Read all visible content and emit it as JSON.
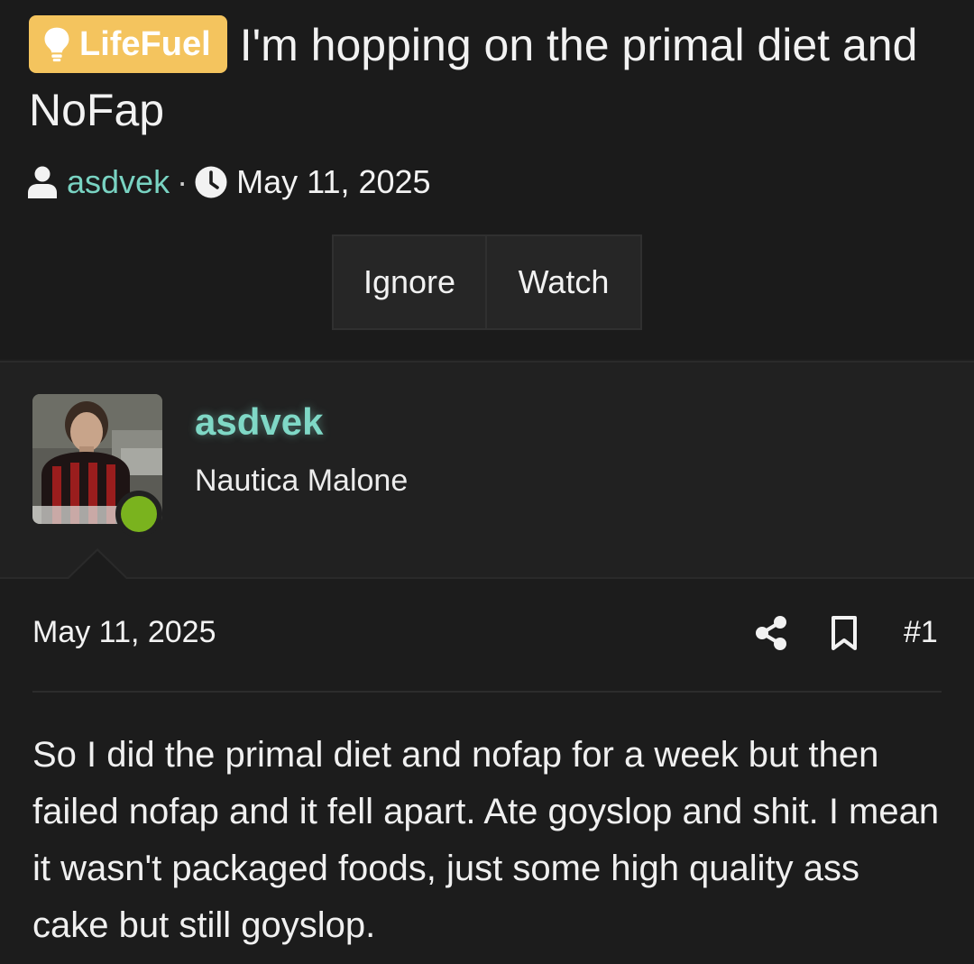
{
  "thread": {
    "prefix": "LifeFuel",
    "prefix_color": "#f4c45e",
    "title": "I'm hopping on the primal diet and NoFap",
    "author": "asdvek",
    "separator": "·",
    "date": "May 11, 2025"
  },
  "actions": {
    "ignore": "Ignore",
    "watch": "Watch"
  },
  "post": {
    "username": "asdvek",
    "user_title": "Nautica Malone",
    "online_color": "#7ab31e",
    "date": "May 11, 2025",
    "number": "#1",
    "body": "So I did the primal diet and nofap for a week but then failed nofap and it fell apart. Ate goyslop and shit. I mean it wasn't packaged foods, just some high quality ass cake but still goyslop."
  },
  "icons": {
    "prefix": "lightbulb-icon",
    "author": "user-icon",
    "date": "clock-icon",
    "share": "share-icon",
    "bookmark": "bookmark-icon"
  }
}
